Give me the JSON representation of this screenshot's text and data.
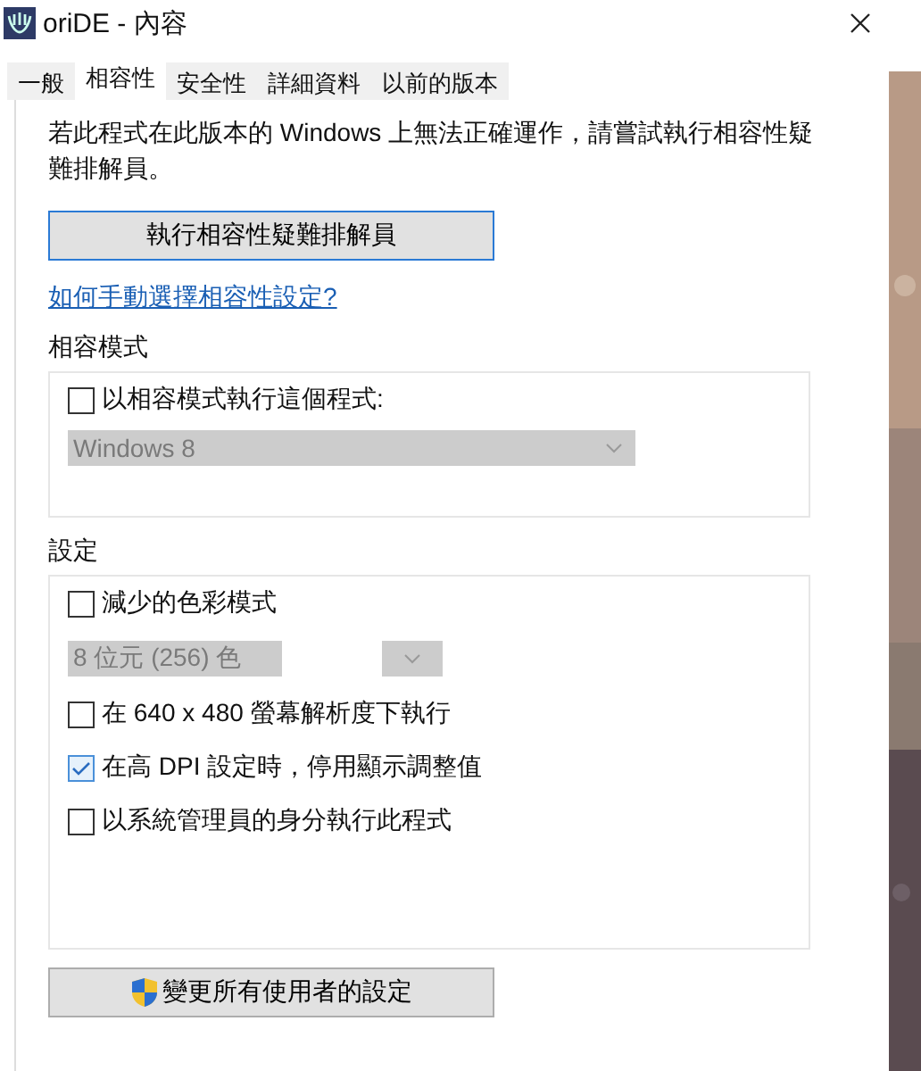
{
  "window": {
    "title": "oriDE - 內容"
  },
  "tabs": [
    {
      "label": "一般",
      "selected": false
    },
    {
      "label": "相容性",
      "selected": true
    },
    {
      "label": "安全性",
      "selected": false
    },
    {
      "label": "詳細資料",
      "selected": false
    },
    {
      "label": "以前的版本",
      "selected": false
    }
  ],
  "intro": "若此程式在此版本的 Windows 上無法正確運作，請嘗試執行相容性疑難排解員。",
  "troubleshoot_button": "執行相容性疑難排解員",
  "help_link": "如何手動選擇相容性設定?",
  "compat_mode": {
    "title": "相容模式",
    "checkbox": {
      "label": "以相容模式執行這個程式:",
      "checked": false
    },
    "dropdown": {
      "value": "Windows 8",
      "disabled": true
    }
  },
  "settings": {
    "title": "設定",
    "items": [
      {
        "kind": "checkbox",
        "label": "減少的色彩模式",
        "checked": false
      },
      {
        "kind": "dropdown",
        "value": "8 位元 (256) 色",
        "disabled": true
      },
      {
        "kind": "checkbox",
        "label": "在 640 x 480 螢幕解析度下執行",
        "checked": false
      },
      {
        "kind": "checkbox",
        "label": "在高 DPI 設定時，停用顯示調整值",
        "checked": true
      },
      {
        "kind": "checkbox",
        "label": "以系統管理員的身分執行此程式",
        "checked": false
      }
    ]
  },
  "all_users_button": "變更所有使用者的設定"
}
